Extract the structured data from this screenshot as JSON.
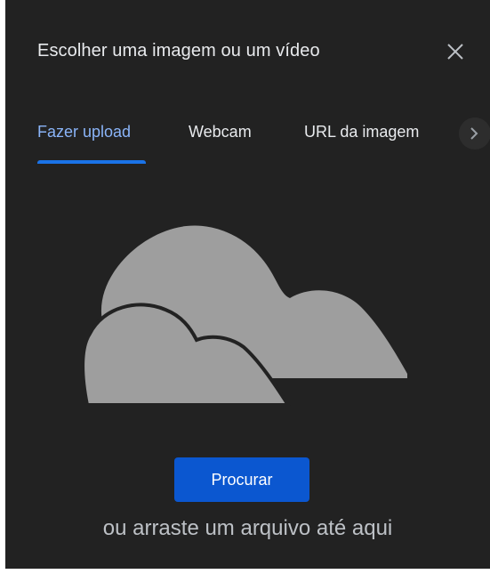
{
  "dialog": {
    "title": "Escolher uma imagem ou um vídeo",
    "close_icon": "close-icon"
  },
  "tabs": [
    {
      "label": "Fazer upload",
      "active": true
    },
    {
      "label": "Webcam",
      "active": false
    },
    {
      "label": "URL da imagem",
      "active": false
    }
  ],
  "tab_scroll_icon": "chevron-right-icon",
  "upload": {
    "illustration_icon": "cloud-icon",
    "browse_label": "Procurar",
    "drag_hint": "ou arraste um arquivo até aqui"
  },
  "colors": {
    "background": "#222222",
    "accent": "#8ab4f8",
    "indicator": "#1a73e8",
    "button": "#0b57d0",
    "text": "#e8eaed",
    "muted_text": "#bdc1c6"
  }
}
